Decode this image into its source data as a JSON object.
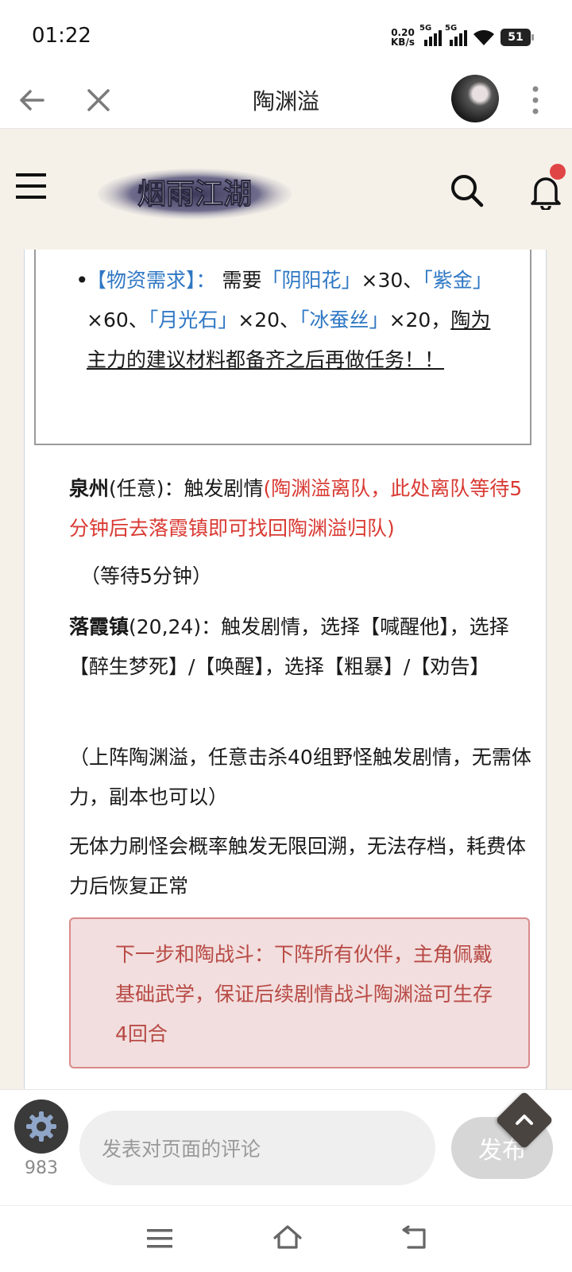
{
  "status_bar": {
    "time": "01:22",
    "net_speed_value": "0.20",
    "net_speed_unit": "KB/s",
    "signal_1": "5G",
    "signal_2": "5G",
    "battery": "51"
  },
  "top_bar": {
    "title": "陶渊溢"
  },
  "site_header": {
    "logo_text": "烟雨江湖",
    "accent_color": "#e04545"
  },
  "content": {
    "boxed_item": {
      "tag": "【物资需求】：",
      "text_a": "需要",
      "m1": "「阴阳花」",
      "q1": "×30、",
      "m2": "「紫金」",
      "q2": "×60、",
      "m3": "「月光石」",
      "q3": "×20、",
      "m4": "「冰蚕丝」",
      "q4": "×20，",
      "underlined": "陶为主力的建议材料都备齐之后再做任务！！"
    },
    "p1": {
      "place": "泉州",
      "coords": "(任意)",
      "text": "：触发剧情",
      "red": "(陶渊溢离队，此处离队等待5分钟后去落霞镇即可找回陶渊溢归队)"
    },
    "p2": "（等待5分钟）",
    "p3": {
      "place": "落霞镇",
      "coords": "(20,24)",
      "text": "：触发剧情，选择【喊醒他】，选择【醉生梦死】/【唤醒】，选择【粗暴】/【劝告】"
    },
    "p4": "（上阵陶渊溢，任意击杀40组野怪触发剧情，无需体力，副本也可以）",
    "p5": "无体力刷怪会概率触发无限回溯，无法存档，耗费体力后恢复正常",
    "callout": "下一步和陶战斗：下阵所有伙伴，主角佩戴基础武学，保证后续剧情战斗陶渊溢可生存4回合"
  },
  "comment_bar": {
    "count": "983",
    "placeholder": "发表对页面的评论",
    "post_label": "发布"
  }
}
